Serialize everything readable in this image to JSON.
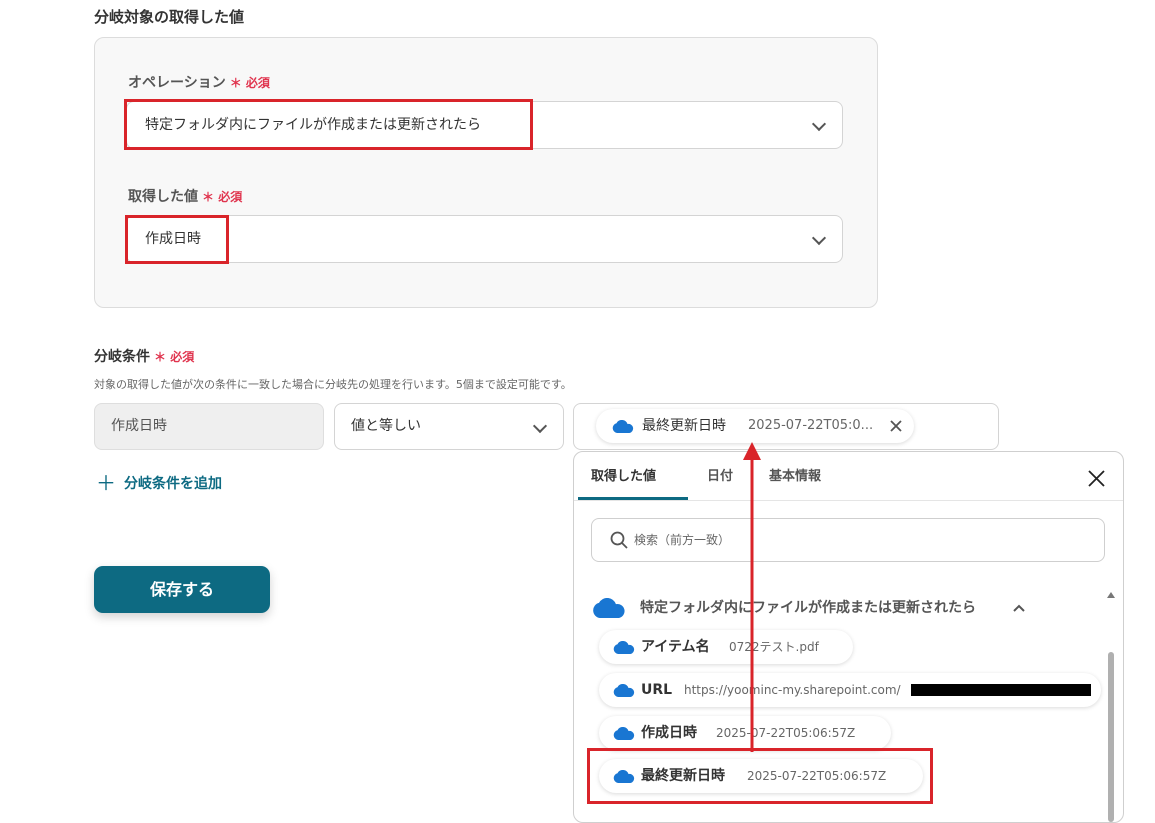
{
  "branch_target": {
    "title": "分岐対象の取得した値",
    "operation": {
      "label": "オペレーション",
      "required": "必須",
      "value": "特定フォルダ内にファイルが作成または更新されたら"
    },
    "acquired_value": {
      "label": "取得した値",
      "required": "必須",
      "value": "作成日時"
    }
  },
  "branch_conditions": {
    "title": "分岐条件",
    "required": "必須",
    "description": "対象の取得した値が次の条件に一致した場合に分岐先の処理を行います。5個まで設定可能です。",
    "row": {
      "field": "作成日時",
      "operator": "値と等しい",
      "value_chip_name": "最終更新日時",
      "value_chip_value": "2025-07-22T05:0..."
    },
    "add_label": "分岐条件を追加"
  },
  "save_label": "保存する",
  "dropdown": {
    "tabs": [
      "取得した値",
      "日付",
      "基本情報"
    ],
    "active_tab": 0,
    "search_placeholder": "検索（前方一致）",
    "group_title": "特定フォルダ内にファイルが作成または更新されたら",
    "items": [
      {
        "name": "アイテム名",
        "value": "0722テスト.pdf"
      },
      {
        "name": "URL",
        "value": "https://yoominc-my.sharepoint.com/"
      },
      {
        "name": "作成日時",
        "value": "2025-07-22T05:06:57Z"
      },
      {
        "name": "最終更新日時",
        "value": "2025-07-22T05:06:57Z"
      }
    ]
  },
  "colors": {
    "accent": "#0d6a82",
    "required": "#e0344e",
    "highlight": "#d9242a",
    "cloud": "#1976d2"
  },
  "icons": [
    "chevron-down-icon",
    "cloud-icon",
    "close-icon",
    "search-icon",
    "plus-icon",
    "chevron-up-icon"
  ]
}
